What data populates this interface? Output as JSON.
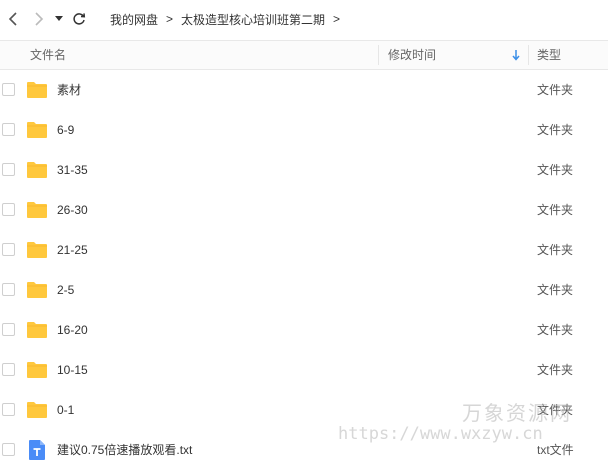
{
  "breadcrumb": [
    "我的网盘",
    "太极造型核心培训班第二期"
  ],
  "breadcrumb_separator": ">",
  "columns": {
    "name": "文件名",
    "time": "修改时间",
    "type": "类型"
  },
  "files": [
    {
      "name": "素材",
      "type": "文件夹",
      "icon": "folder-icon"
    },
    {
      "name": "6-9",
      "type": "文件夹",
      "icon": "folder-icon"
    },
    {
      "name": "31-35",
      "type": "文件夹",
      "icon": "folder-icon"
    },
    {
      "name": "26-30",
      "type": "文件夹",
      "icon": "folder-icon"
    },
    {
      "name": "21-25",
      "type": "文件夹",
      "icon": "folder-icon"
    },
    {
      "name": "2-5",
      "type": "文件夹",
      "icon": "folder-icon"
    },
    {
      "name": "16-20",
      "type": "文件夹",
      "icon": "folder-icon"
    },
    {
      "name": "10-15",
      "type": "文件夹",
      "icon": "folder-icon"
    },
    {
      "name": "0-1",
      "type": "文件夹",
      "icon": "folder-icon"
    },
    {
      "name": "建议0.75倍速播放观看.txt",
      "type": "txt文件",
      "icon": "txt-file-icon"
    }
  ],
  "watermark": {
    "title": "万象资源网",
    "url": "https://www.wxzyw.cn"
  },
  "colors": {
    "folder": "#FFC83D",
    "txt_icon": "#4A8CF7",
    "sort_arrow": "#3B8FE8"
  }
}
